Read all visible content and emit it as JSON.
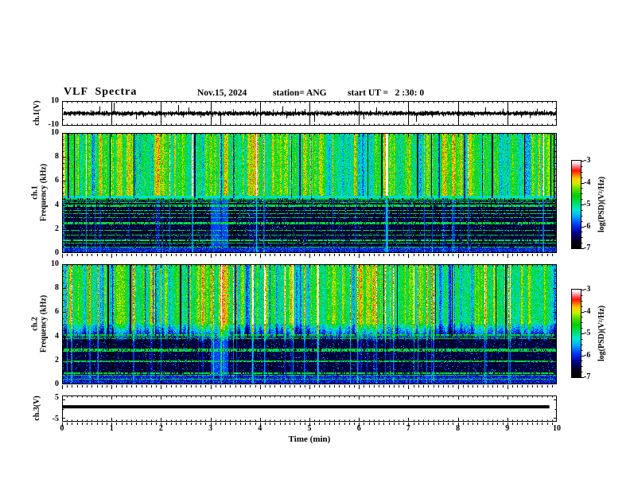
{
  "header": {
    "title": "VLF  Spectra",
    "date": "Nov.15, 2024",
    "station": "station= ANG",
    "start_ut": "start UT =   2 :30: 0"
  },
  "x_axis": {
    "label": "Time  (min)",
    "ticks": [
      "0",
      "1",
      "2",
      "3",
      "4",
      "5",
      "6",
      "7",
      "8",
      "9",
      "10"
    ],
    "range": [
      0,
      10
    ]
  },
  "panels": {
    "ch1_wave": {
      "ylabel": "ch.1(V)",
      "yticks": [
        "10",
        "-10"
      ],
      "ylim": [
        10,
        -10
      ]
    },
    "ch1_spec": {
      "ylabel_line1": "ch.1",
      "ylabel_line2": "Frequency  (kHz)",
      "yticks": [
        "10",
        "8",
        "6",
        "4",
        "2",
        "0"
      ],
      "ylim": [
        0,
        10
      ]
    },
    "ch2_spec": {
      "ylabel_line1": "ch.2",
      "ylabel_line2": "Frequency  (kHz)",
      "yticks": [
        "10",
        "8",
        "6",
        "4",
        "2",
        "0"
      ],
      "ylim": [
        0,
        10
      ]
    },
    "ch3_wave": {
      "ylabel": "ch.3(V)",
      "yticks": [
        "5",
        "-5"
      ],
      "ylim": [
        5,
        -5
      ]
    }
  },
  "colorbars": [
    {
      "label": "log(PSD)(V²/Hz)",
      "ticks": [
        "-3",
        "-4",
        "-5",
        "-6",
        "-7"
      ],
      "range": [
        -3,
        -7
      ]
    },
    {
      "label": "log(PSD)(V²/Hz)",
      "ticks": [
        "-3",
        "-4",
        "-5",
        "-6",
        "-7"
      ],
      "range": [
        -3,
        -7
      ]
    }
  ],
  "colormap": [
    {
      "v": 0.0,
      "c": "#000000"
    },
    {
      "v": 0.08,
      "c": "#00001a"
    },
    {
      "v": 0.18,
      "c": "#000299"
    },
    {
      "v": 0.28,
      "c": "#0040ff"
    },
    {
      "v": 0.36,
      "c": "#00a8ff"
    },
    {
      "v": 0.44,
      "c": "#00e8d0"
    },
    {
      "v": 0.52,
      "c": "#00dd66"
    },
    {
      "v": 0.6,
      "c": "#00cc00"
    },
    {
      "v": 0.68,
      "c": "#66dd00"
    },
    {
      "v": 0.74,
      "c": "#ccee00"
    },
    {
      "v": 0.8,
      "c": "#ffcc00"
    },
    {
      "v": 0.85,
      "c": "#ff6600"
    },
    {
      "v": 0.89,
      "c": "#ff1100"
    },
    {
      "v": 0.93,
      "c": "#ff6666"
    },
    {
      "v": 0.97,
      "c": "#ffccdd"
    },
    {
      "v": 1.0,
      "c": "#ffffff"
    }
  ],
  "chart_data": [
    {
      "type": "line",
      "name": "ch1-voltage-trace",
      "ylabel": "ch.1(V)",
      "xlim": [
        0,
        10
      ],
      "ylim": [
        -10,
        10
      ],
      "description": "broadband noise centered on 0 V, ~±1.5 V envelope, sporadic impulsive spikes",
      "noise_amplitude_v": 1.5,
      "seed": 11,
      "spikes": [
        {
          "t": 0.75,
          "v": 6
        },
        {
          "t": 1.05,
          "v": 9
        },
        {
          "t": 1.5,
          "v": -5
        },
        {
          "t": 2.0,
          "v": -6
        },
        {
          "t": 2.35,
          "v": 7
        },
        {
          "t": 2.55,
          "v": 5
        },
        {
          "t": 3.2,
          "v": -9
        },
        {
          "t": 3.9,
          "v": 4
        },
        {
          "t": 4.45,
          "v": 6
        },
        {
          "t": 5.0,
          "v": -8
        },
        {
          "t": 5.1,
          "v": -7
        },
        {
          "t": 6.1,
          "v": -5
        },
        {
          "t": 6.35,
          "v": 5
        },
        {
          "t": 7.15,
          "v": -7
        },
        {
          "t": 8.55,
          "v": 5
        },
        {
          "t": 8.9,
          "v": 4
        },
        {
          "t": 9.45,
          "v": -4
        },
        {
          "t": 9.6,
          "v": 4
        }
      ]
    },
    {
      "type": "heatmap",
      "name": "ch1-spectrogram",
      "xlim": [
        0,
        10
      ],
      "ylim": [
        0,
        10
      ],
      "zlim": [
        -7,
        -3
      ],
      "zlabel": "log(PSD)(V²/Hz)",
      "description": "green/yellow/red striped emission above ~4.8 kHz, cyan band 4.5-4.8 kHz, dark (< -6.5) below 4.5 kHz crossed by narrow cyan/green horizontal transmitter lines, brighter blue band below 0.5 kHz, burst near 3.2 min",
      "style": "sharp",
      "bright_edge_khz": 4.78,
      "cyan_band_khz": [
        4.55,
        4.78
      ],
      "bottom_band_khz": 0.45,
      "hlines_khz": [
        4.55,
        4.4,
        4.25,
        4.05,
        3.95,
        3.6,
        3.3,
        2.95,
        2.6,
        2.45,
        1.95,
        1.55,
        1.15,
        0.85,
        0.5
      ],
      "event_minutes": [
        3.0,
        3.35
      ],
      "seed": 7
    },
    {
      "type": "heatmap",
      "name": "ch2-spectrogram",
      "xlim": [
        0,
        10
      ],
      "ylim": [
        0,
        10
      ],
      "zlim": [
        -7,
        -3
      ],
      "zlabel": "log(PSD)(V²/Hz)",
      "description": "similar to ch.1 but bright region fades gradually from ~5 kHz down to ~3.6 kHz; dark floor below with horizontal lines near 4.1, 3.9, 3.0-2.7, 2.0, 1.0, 0.8 kHz",
      "style": "gradual",
      "bright_edge_khz": 5.0,
      "fade_to_khz": 3.6,
      "bottom_band_khz": 0.8,
      "hlines_khz": [
        4.15,
        3.95,
        3.85,
        3.0,
        2.9,
        2.75,
        2.0,
        1.9,
        1.0,
        0.8,
        0.45
      ],
      "event_minutes": [
        3.0,
        3.35
      ],
      "seed": 13
    },
    {
      "type": "line",
      "name": "ch3-voltage-trace",
      "ylabel": "ch.3(V)",
      "xlim": [
        0,
        10
      ],
      "ylim": [
        -5,
        5
      ],
      "description": "constant thick flat line (saturated/DC) at about +1 V ending near 9.85 min",
      "value_v": 1.0,
      "x_extent_min": [
        0,
        9.85
      ],
      "thickness_px": 4
    }
  ]
}
